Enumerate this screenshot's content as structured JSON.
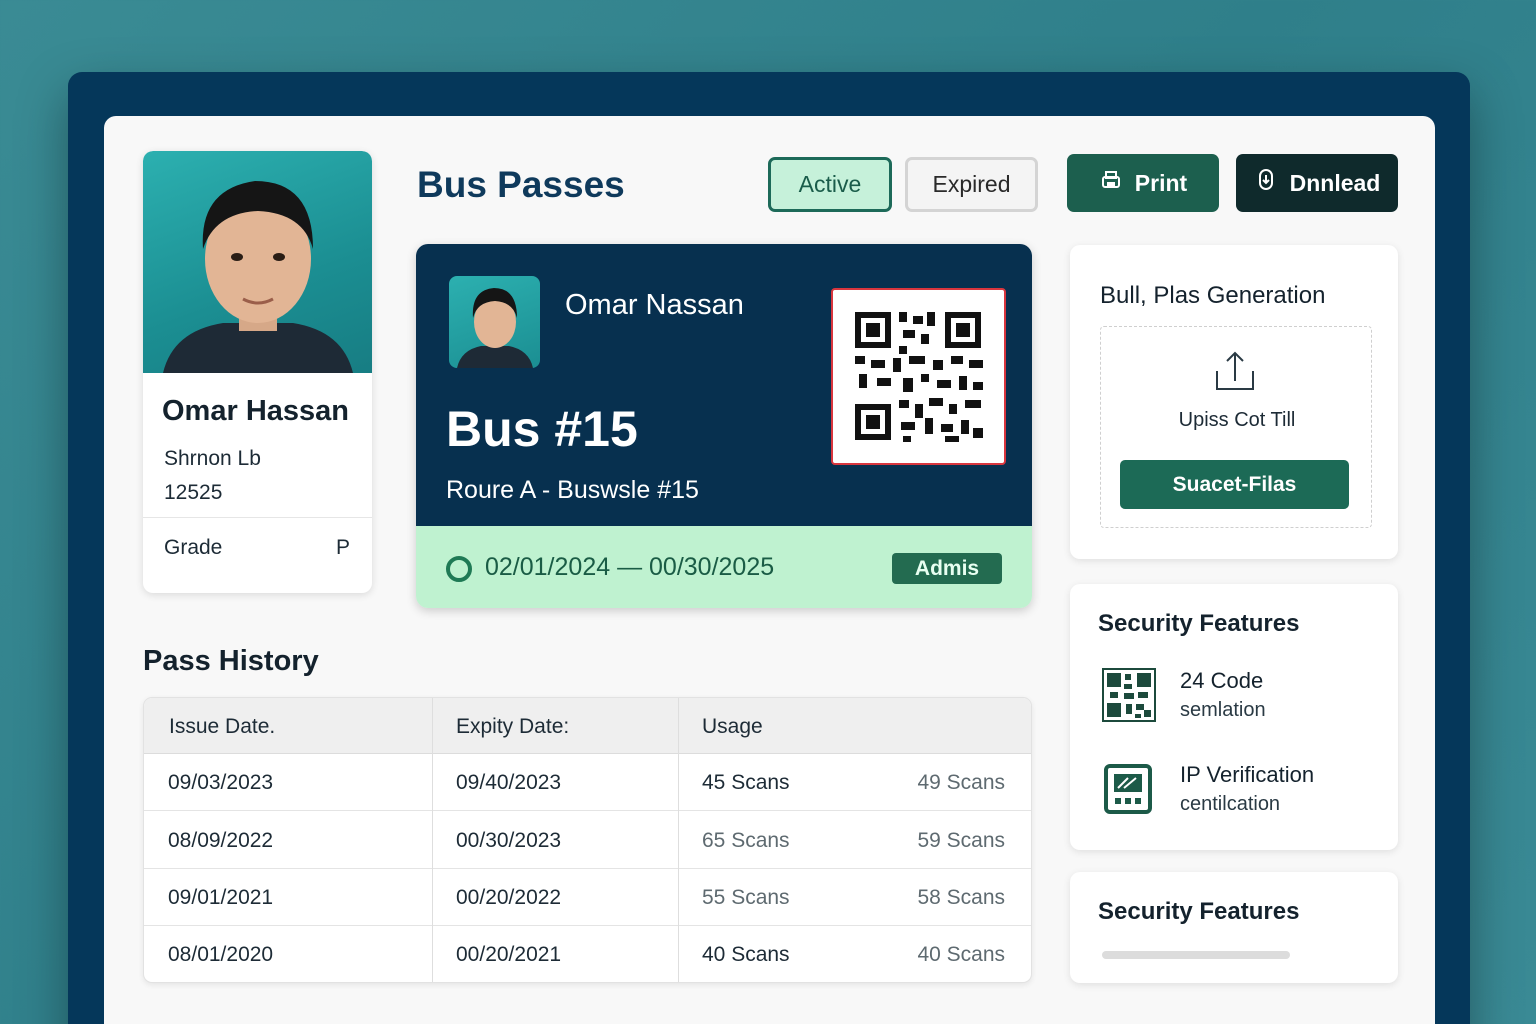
{
  "profile": {
    "name": "Omar Hassan",
    "school": "Shrnon Lb",
    "id": "12525",
    "grade_label": "Grade",
    "grade_value": "P"
  },
  "header": {
    "title": "Bus Passes",
    "tabs": [
      {
        "label": "Active",
        "selected": true
      },
      {
        "label": "Expired",
        "selected": false
      }
    ],
    "print_label": "Print",
    "download_label": "Dnnlead"
  },
  "pass": {
    "name": "Omar Nassan",
    "bus": "Bus #15",
    "route": "Roure A - Buswsle #15",
    "dates": "02/01/2024 — 00/30/2025",
    "badge": "Admis",
    "qr_icon": "qr-code-icon"
  },
  "history": {
    "title": "Pass History",
    "columns": [
      "Issue Date.",
      "Expity Date:",
      "Usage"
    ],
    "rows": [
      {
        "issue": "09/03/2023",
        "expiry": "09/40/2023",
        "usage": "45 Scans",
        "total": "49 Scans"
      },
      {
        "issue": "08/09/2022",
        "expiry": "00/30/2023",
        "usage": "65 Scans",
        "total": "59 Scans"
      },
      {
        "issue": "09/01/2021",
        "expiry": "00/20/2022",
        "usage": "55 Scans",
        "total": "58 Scans"
      },
      {
        "issue": "08/01/2020",
        "expiry": "00/20/2021",
        "usage": "40 Scans",
        "total": "40 Scans"
      }
    ]
  },
  "generation_panel": {
    "title": "Bull, Plas Generation",
    "upload_text": "Upiss Cot Till",
    "select_label": "Suacet-Filas",
    "upload_icon": "upload-icon"
  },
  "security_panel": {
    "title": "Security Features",
    "features": [
      {
        "title": "24 Code",
        "subtitle": "semlation",
        "icon": "qr-code-icon"
      },
      {
        "title": "IP Verification",
        "subtitle": "centilcation",
        "icon": "verification-icon"
      }
    ]
  },
  "security_panel_2": {
    "title": "Security Features",
    "progress": 0
  },
  "colors": {
    "frame": "#05375a",
    "pass_dark": "#07304f",
    "pass_light": "#bff2d0",
    "accent_green": "#1c6a56",
    "download_dark": "#0f2a2c"
  }
}
